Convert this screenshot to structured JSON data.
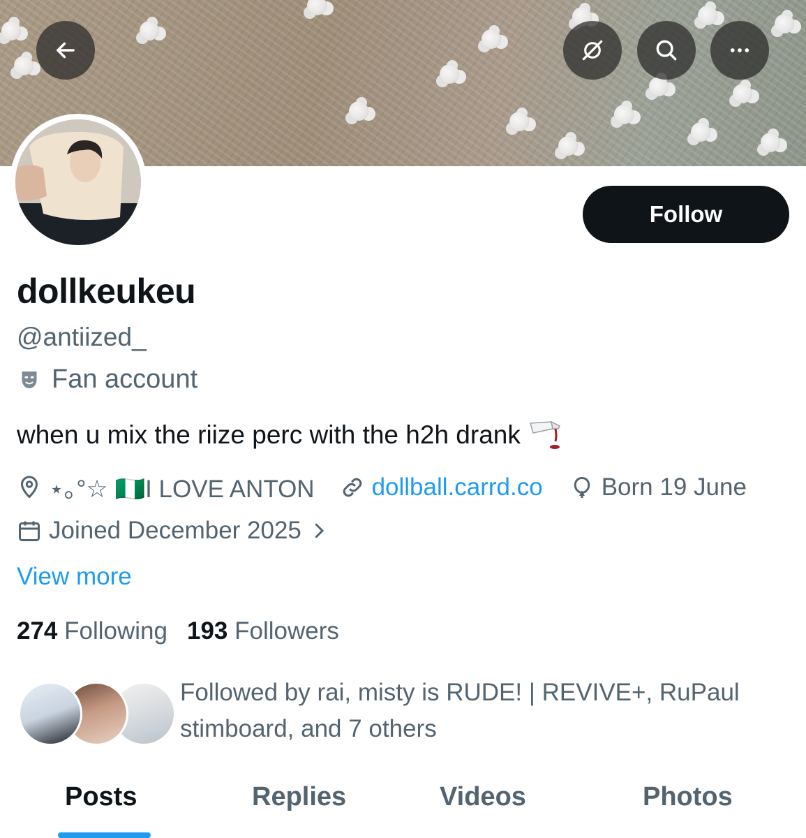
{
  "header": {
    "back_icon": "arrow-left-icon",
    "grok_icon": "grok-icon",
    "search_icon": "search-icon",
    "more_icon": "more-dots-icon"
  },
  "profile": {
    "follow_label": "Follow",
    "display_name": "dollkeukeu",
    "handle": "@antiized_",
    "category": "Fan account",
    "bio": "when u mix the riize perc with the h2h drank",
    "location": "⋆｡°☆ 🇳🇬I LOVE ANTON",
    "website": "dollball.carrd.co",
    "birthday": "Born 19 June",
    "joined": "Joined December 2025",
    "view_more": "View more"
  },
  "stats": {
    "following_count": "274",
    "following_label": "Following",
    "followers_count": "193",
    "followers_label": "Followers"
  },
  "followed_by": {
    "text": "Followed by rai, misty is RUDE! | REVIVE+, RuPaul stimboard, and 7 others"
  },
  "tabs": [
    {
      "label": "Posts",
      "active": true
    },
    {
      "label": "Replies",
      "active": false
    },
    {
      "label": "Videos",
      "active": false
    },
    {
      "label": "Photos",
      "active": false
    }
  ],
  "colors": {
    "accent": "#1d9bf0",
    "text_primary": "#0f1419",
    "text_secondary": "#536471"
  }
}
